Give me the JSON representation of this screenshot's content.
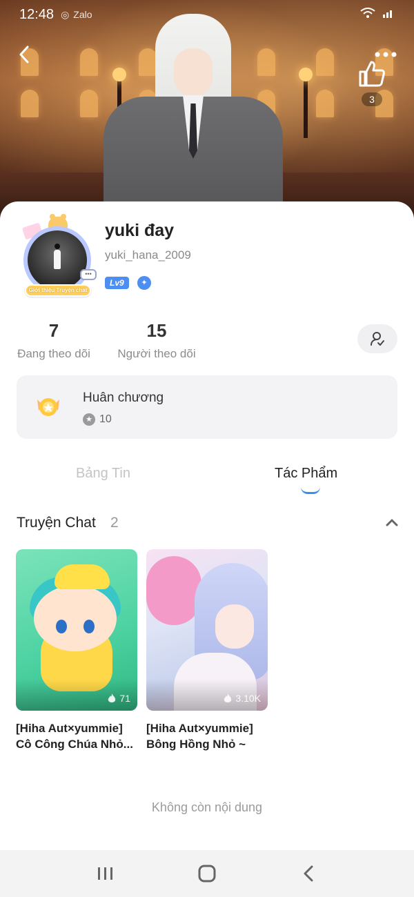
{
  "status_bar": {
    "time": "12:48",
    "notification_label": "Zalo"
  },
  "header": {
    "like_count": "3",
    "icons": {
      "back": "chevron-left-icon",
      "more": "more-horizontal-icon",
      "like": "thumbs-up-icon"
    }
  },
  "profile": {
    "display_name": "yuki đay",
    "username": "yuki_hana_2009",
    "level": "Lv9",
    "avatar_frame_label": "Giới thiệu Truyện chat",
    "following_count": "7",
    "following_label": "Đang theo dõi",
    "followers_count": "15",
    "followers_label": "Người theo dõi",
    "edit_icon": "user-edit-icon"
  },
  "medals": {
    "title": "Huân chương",
    "count": "10"
  },
  "tabs": [
    {
      "label": "Bảng Tin",
      "active": false
    },
    {
      "label": "Tác Phẩm",
      "active": true
    }
  ],
  "section": {
    "title": "Truyện Chat",
    "count": "2",
    "stories": [
      {
        "title_line1": "[Hiha Aut×yummie]",
        "title_line2": "Cô Công Chúa Nhỏ...",
        "hot_count": "71"
      },
      {
        "title_line1": "[Hiha Aut×yummie]",
        "title_line2": "Bông Hồng Nhỏ ~",
        "hot_count": "3.10K"
      }
    ]
  },
  "footer_text": "Không còn nội dung",
  "colors": {
    "accent": "#3b8fe8",
    "level_badge": "#4d8ff0",
    "card_bg": "#f3f3f5"
  }
}
